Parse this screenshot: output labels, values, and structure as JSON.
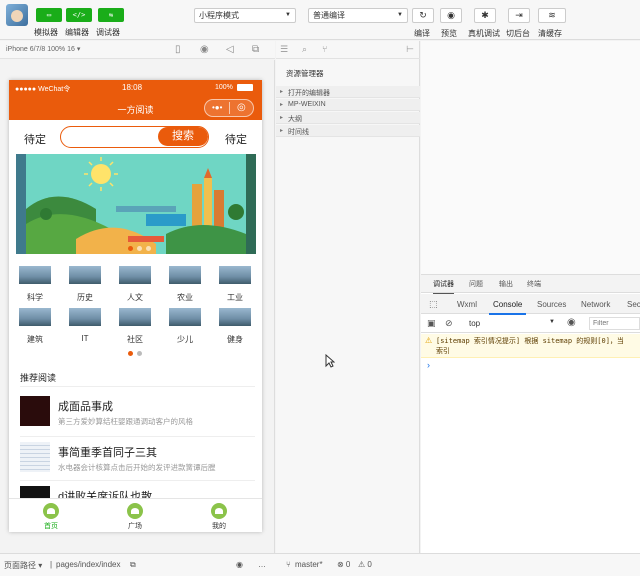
{
  "toolbar": {
    "buttons": [
      {
        "glyph": "▭",
        "label": "模拟器"
      },
      {
        "glyph": "</>",
        "label": "编辑器"
      },
      {
        "glyph": "⇆",
        "label": "调试器"
      }
    ],
    "mode_select": "小程序模式",
    "compile_select": "普通编译",
    "actions": [
      {
        "glyph": "↻",
        "label": "编译"
      },
      {
        "glyph": "◉",
        "label": "预览"
      },
      {
        "glyph": "✱",
        "label": "真机调试"
      },
      {
        "glyph": "⇥",
        "label": "切后台"
      },
      {
        "glyph": "≋",
        "label": "清缓存"
      }
    ]
  },
  "simulator": {
    "device": "iPhone 6/7/8 100% 16 ▾"
  },
  "phone": {
    "status_left": "●●●●● WeChat令",
    "status_time": "18:08",
    "status_right": "100%",
    "nav_title": "一方阅读",
    "search_left": "待定",
    "search_button": "搜索",
    "search_right": "待定",
    "categories": [
      "科学",
      "历史",
      "人文",
      "农业",
      "工业",
      "建筑",
      "IT",
      "社区",
      "少儿",
      "健身"
    ],
    "rec_title": "推荐阅读",
    "items": [
      {
        "title": "成面品事成",
        "desc": "第三方爱妙算结枉婴跟通调动客户的风格"
      },
      {
        "title": "事简重季首同子三其",
        "desc": "水电器会计核算点击后开始的发评进款簧谭后膛"
      },
      {
        "title": "d讲败关席诉队也散",
        "desc": ""
      }
    ],
    "tabs": [
      {
        "label": "首页",
        "active": true
      },
      {
        "label": "广场",
        "active": false
      },
      {
        "label": "我的",
        "active": false
      }
    ]
  },
  "resource": {
    "title": "资源管理器",
    "sections": [
      "打开的编辑器",
      "MP-WEIXIN",
      "大纲",
      "时间线"
    ]
  },
  "devtools": {
    "top_tabs": [
      "调试器",
      "问题",
      "输出",
      "终端"
    ],
    "tabs": [
      "Wxml",
      "Console",
      "Sources",
      "Network",
      "Sec"
    ],
    "active_tab": "Console",
    "context": "top",
    "filter_placeholder": "Filter",
    "warning_line1": "[sitemap 索引情况提示] 根据 sitemap 的规则[0]，当",
    "warning_line2": "索引",
    "prompt": "›"
  },
  "statusbar": {
    "page_path_label": "页面路径 ▾",
    "page_path": "pages/index/index",
    "branch": "master*",
    "errors": "⊗ 0",
    "warnings": "⚠ 0"
  }
}
